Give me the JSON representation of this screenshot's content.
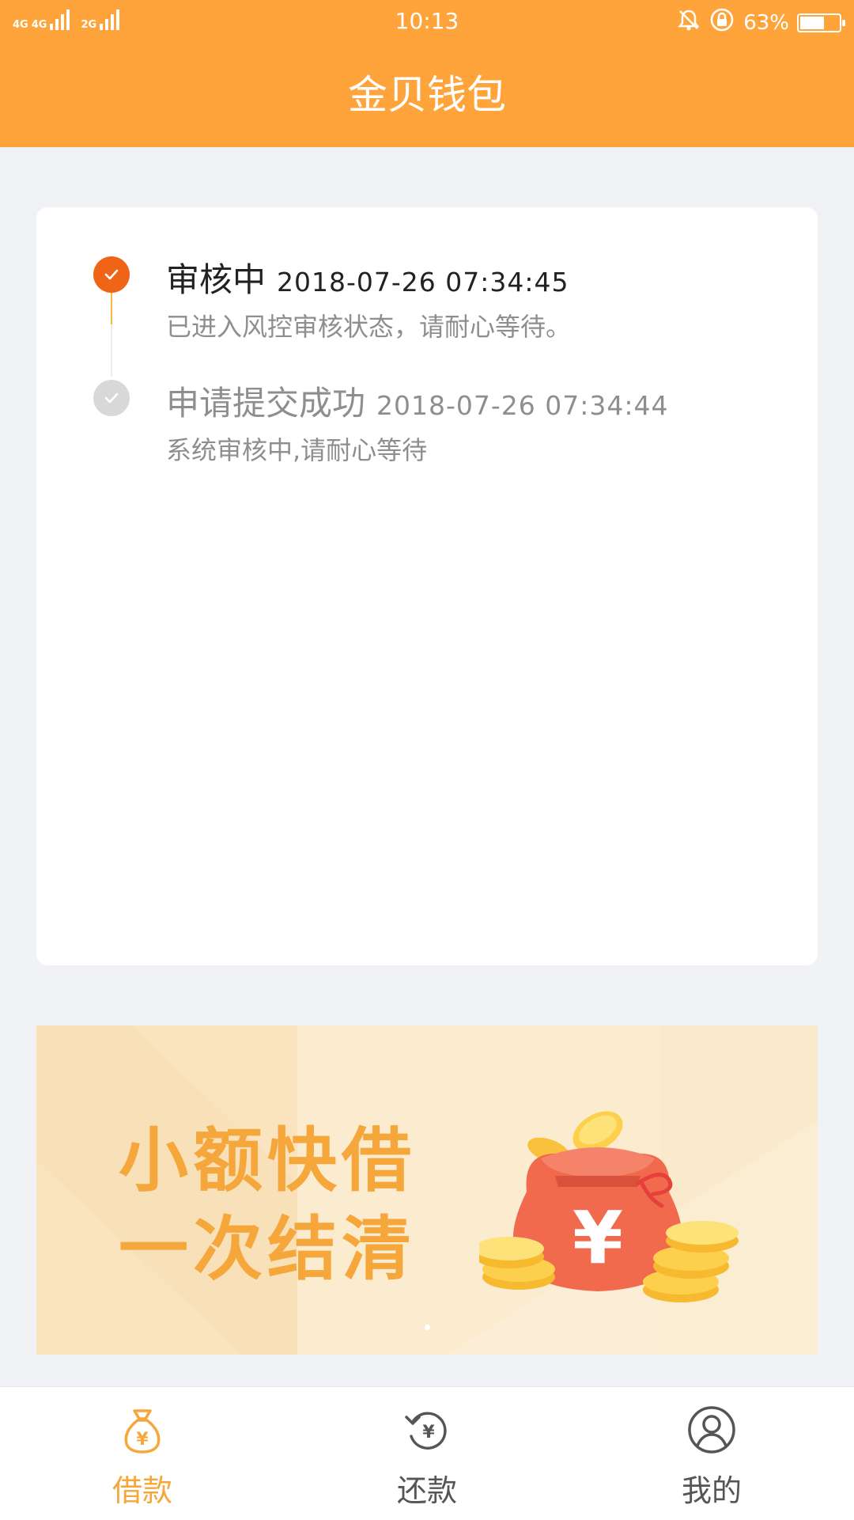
{
  "status_bar": {
    "network_1": "4G",
    "network_2": "4G",
    "network_3": "2G",
    "time": "10:13",
    "battery": "63%",
    "battery_level": 0.63
  },
  "header": {
    "title": "金贝钱包"
  },
  "progress": {
    "steps": [
      {
        "name": "审核中",
        "time": "2018-07-26 07:34:45",
        "desc": "已进入风控审核状态，请耐心等待。",
        "state": "current"
      },
      {
        "name": "申请提交成功",
        "time": "2018-07-26 07:34:44",
        "desc": "系统审核中,请耐心等待",
        "state": "done"
      }
    ]
  },
  "banner": {
    "line1": "小额快借",
    "line2": "一次结清",
    "symbol": "¥",
    "page_indicator_count": 1
  },
  "bottom_nav": {
    "items": [
      {
        "label": "借款",
        "icon": "money-bag-icon",
        "active": true
      },
      {
        "label": "还款",
        "icon": "repay-cycle-icon",
        "active": false
      },
      {
        "label": "我的",
        "icon": "user-profile-icon",
        "active": false
      }
    ]
  },
  "colors": {
    "accent": "#ffa43a",
    "step_current": "#f06418",
    "step_done": "#d8d8d8",
    "nav_active": "#f6a73b",
    "nav_inactive": "#555555"
  }
}
